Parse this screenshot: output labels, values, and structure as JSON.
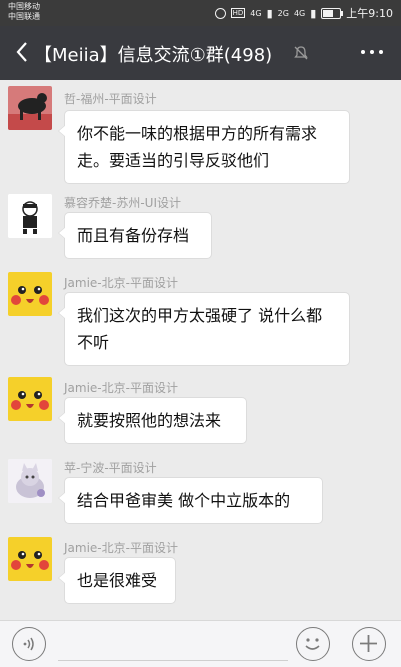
{
  "status_bar": {
    "carrier_1": "中国移动",
    "carrier_2": "中国联通",
    "hd": "HD",
    "net_1": "4G",
    "net_2": "2G",
    "net_3": "4G",
    "battery_level": 0.6,
    "time": "上午9:10"
  },
  "header": {
    "title": "【Meiia】信息交流①群(498)",
    "back_icon": "chevron-left-icon",
    "mute_icon": "bell-muted-icon",
    "more_icon": "more-dots-icon"
  },
  "messages": [
    {
      "sender": "哲-福州-平面设计",
      "lines": [
        "你不能一味的根据甲方的所有需求",
        "走。要适当的引导反驳他们"
      ],
      "avatar": "dark-figure-avatar"
    },
    {
      "sender": "慕容乔楚-苏州-UI设计",
      "lines": [
        "而且有备份存档"
      ],
      "avatar": "cartoon-figure-avatar"
    },
    {
      "sender": "Jamie-北京-平面设计",
      "lines": [
        "我们这次的甲方太强硬了 说什么都",
        "不听"
      ],
      "avatar": "pikachu-avatar"
    },
    {
      "sender": "Jamie-北京-平面设计",
      "lines": [
        "就要按照他的想法来"
      ],
      "avatar": "pikachu-avatar"
    },
    {
      "sender": "苹-宁波-平面设计",
      "lines": [
        "结合甲爸审美 做个中立版本的"
      ],
      "avatar": "cat-avatar"
    },
    {
      "sender": "Jamie-北京-平面设计",
      "lines": [
        "也是很难受"
      ],
      "avatar": "pikachu-avatar"
    }
  ],
  "input_bar": {
    "voice_icon": "voice-icon",
    "emoji_icon": "emoji-icon",
    "plus_icon": "plus-icon",
    "text_value": ""
  }
}
